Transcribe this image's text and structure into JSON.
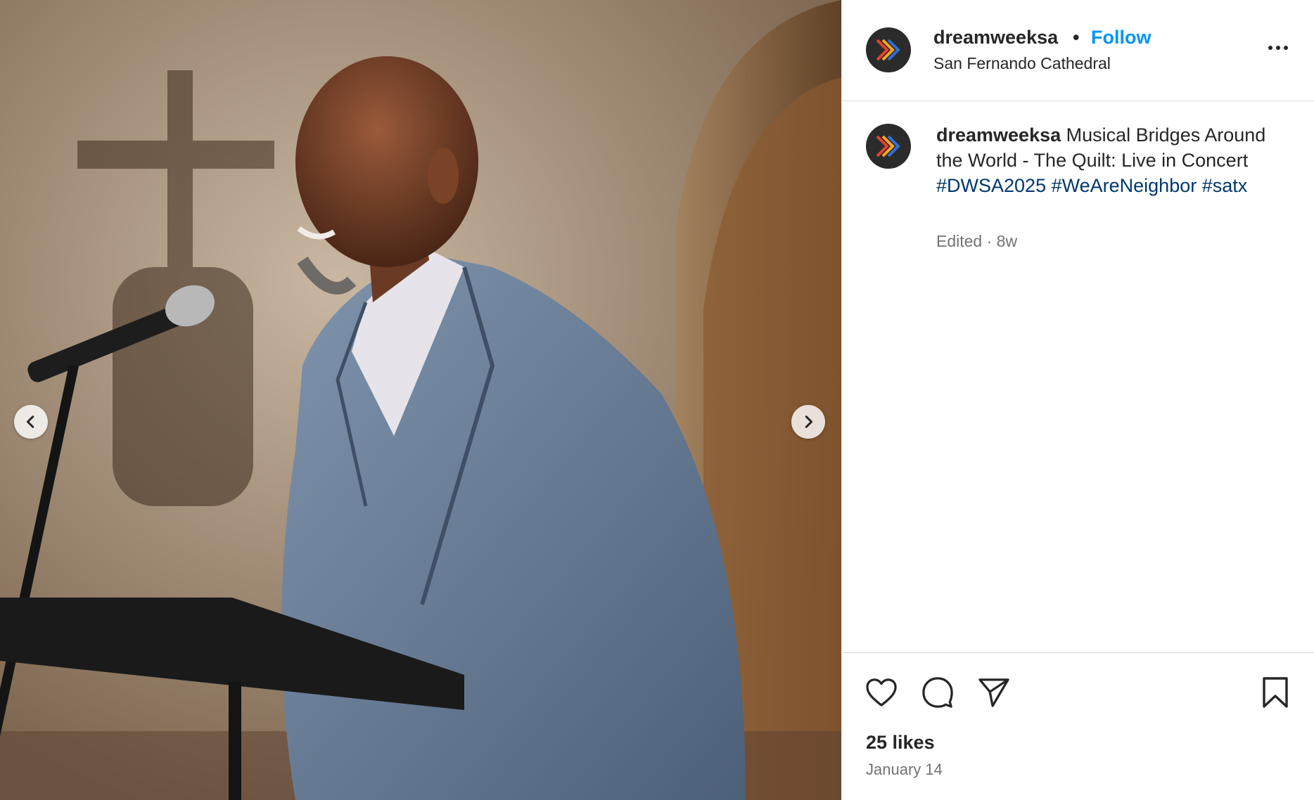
{
  "post": {
    "username": "dreamweeksa",
    "separator": "•",
    "follow_label": "Follow",
    "location": "San Fernando Cathedral",
    "caption": {
      "username": "dreamweeksa",
      "text": "Musical Bridges Around the World - The Quilt: Live in Concert",
      "hashtags": [
        "#DWSA2025",
        "#WeAreNeighbor",
        "#satx"
      ]
    },
    "edited_label": "Edited",
    "meta_separator": "·",
    "age": "8w",
    "likes": "25 likes",
    "date": "January 14"
  },
  "icons": {
    "prev": "chevron-left-icon",
    "next": "chevron-right-icon",
    "more": "more-options-icon",
    "like": "heart-icon",
    "comment": "comment-icon",
    "share": "send-icon",
    "save": "bookmark-icon"
  },
  "colors": {
    "follow": "#0095f6",
    "hashtag": "#00376b",
    "secondary_text": "#737373",
    "avatar_bg": "#2b2b2b",
    "logo_stripes": [
      "#e8412c",
      "#f6a623",
      "#2f6fd6"
    ]
  }
}
